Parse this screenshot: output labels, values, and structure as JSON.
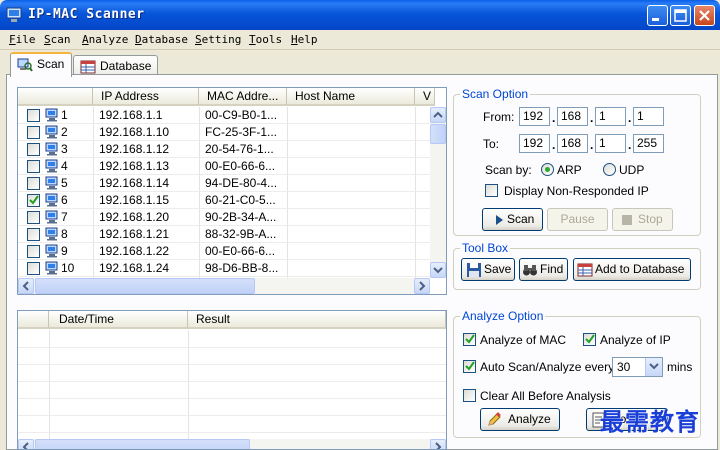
{
  "window": {
    "title": "IP-MAC Scanner"
  },
  "menu": [
    "File",
    "Scan",
    "Analyze",
    "Database",
    "Setting",
    "Tools",
    "Help"
  ],
  "tabs": [
    {
      "label": "Scan",
      "active": true
    },
    {
      "label": "Database",
      "active": false
    }
  ],
  "scan_list": {
    "columns": [
      "",
      "IP Address",
      "MAC Addre...",
      "Host Name",
      "V"
    ],
    "rows": [
      {
        "num": "1",
        "ip": "192.168.1.1",
        "mac": "00-C9-B0-1...",
        "host": "",
        "checked": false
      },
      {
        "num": "2",
        "ip": "192.168.1.10",
        "mac": "FC-25-3F-1...",
        "host": "",
        "checked": false
      },
      {
        "num": "3",
        "ip": "192.168.1.12",
        "mac": "20-54-76-1...",
        "host": "",
        "checked": false
      },
      {
        "num": "4",
        "ip": "192.168.1.13",
        "mac": "00-E0-66-6...",
        "host": "",
        "checked": false
      },
      {
        "num": "5",
        "ip": "192.168.1.14",
        "mac": "94-DE-80-4...",
        "host": "",
        "checked": false
      },
      {
        "num": "6",
        "ip": "192.168.1.15",
        "mac": "60-21-C0-5...",
        "host": "",
        "checked": true
      },
      {
        "num": "7",
        "ip": "192.168.1.20",
        "mac": "90-2B-34-A...",
        "host": "",
        "checked": false
      },
      {
        "num": "8",
        "ip": "192.168.1.21",
        "mac": "88-32-9B-A...",
        "host": "",
        "checked": false
      },
      {
        "num": "9",
        "ip": "192.168.1.22",
        "mac": "00-E0-66-6...",
        "host": "",
        "checked": false
      },
      {
        "num": "10",
        "ip": "192.168.1.24",
        "mac": "98-D6-BB-8...",
        "host": "",
        "checked": false
      }
    ]
  },
  "scan_option": {
    "title": "Scan Option",
    "from_label": "From:",
    "to_label": "To:",
    "from": [
      "192",
      "168",
      "1",
      "1"
    ],
    "to": [
      "192",
      "168",
      "1",
      "255"
    ],
    "scan_by_label": "Scan by:",
    "arp_label": "ARP",
    "udp_label": "UDP",
    "selected_protocol": "ARP",
    "non_responded_label": "Display Non-Responded IP",
    "non_responded_checked": false,
    "scan_button": "Scan",
    "pause_button": "Pause",
    "stop_button": "Stop"
  },
  "tool_box": {
    "title": "Tool Box",
    "save_button": "Save",
    "find_button": "Find",
    "add_button": "Add to Database"
  },
  "result_list": {
    "columns": [
      "",
      "Date/Time",
      "Result"
    ]
  },
  "analyze_option": {
    "title": "Analyze Option",
    "analyze_mac_label": "Analyze of MAC",
    "analyze_mac_checked": true,
    "analyze_ip_label": "Analyze of IP",
    "analyze_ip_checked": true,
    "auto_label": "Auto Scan/Analyze every",
    "auto_checked": true,
    "interval": "30",
    "mins_label": "mins",
    "clear_label": "Clear All Before Analysis",
    "clear_checked": false,
    "analyze_button": "Analyze",
    "second_button": "Ro..."
  },
  "watermark": "最需教育",
  "colors": {
    "titlebar": "#0755d9",
    "group_title": "#0046d5",
    "window_bg": "#ece9d8"
  }
}
